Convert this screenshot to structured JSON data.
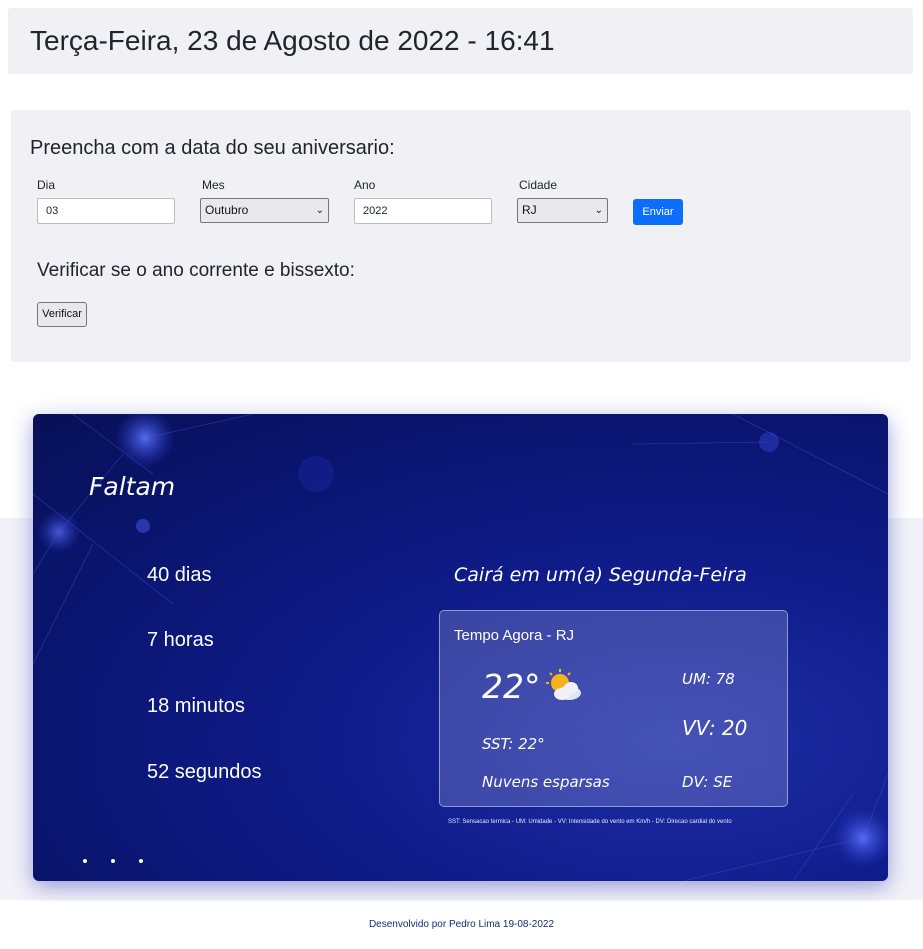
{
  "header": {
    "title": "Terça-Feira, 23 de Agosto de 2022 - 16:41"
  },
  "form": {
    "title": "Preencha com a data do seu aniversario:",
    "dia_label": "Dia",
    "dia_value": "03",
    "mes_label": "Mes",
    "mes_value": "Outubro",
    "ano_label": "Ano",
    "ano_value": "2022",
    "cidade_label": "Cidade",
    "cidade_value": "RJ",
    "submit_label": "Enviar",
    "leap_title": "Verificar se o ano corrente e bissexto:",
    "verify_label": "Verificar"
  },
  "countdown": {
    "title": "Faltam",
    "days": "40 dias",
    "hours": "7 horas",
    "minutes": "18 minutos",
    "seconds": "52 segundos",
    "weekday": "Cairá em um(a) Segunda-Feira"
  },
  "weather": {
    "title": "Tempo Agora - RJ",
    "temp": "22°",
    "icon": "partly-cloudy-icon",
    "humidity": "UM: 78",
    "wind_speed": "VV: 20",
    "feels_like": "SST: 22°",
    "description": "Nuvens esparsas",
    "wind_dir": "DV: SE",
    "legend": "SST: Sensacao termica - UM: Umidade - VV: Intensidade do vento em Km/h - DV: Direcao cardial do vento"
  },
  "footer": {
    "text": "Desenvolvido por Pedro Lima 19-08-2022"
  },
  "colors": {
    "accent": "#0d6efd",
    "hero": "#101d8c"
  }
}
